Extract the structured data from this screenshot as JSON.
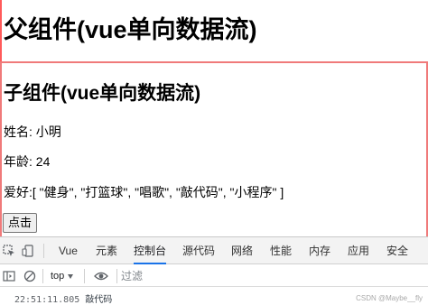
{
  "parent": {
    "title": "父组件(vue单向数据流)"
  },
  "child": {
    "title": "子组件(vue单向数据流)",
    "name_line": "姓名: 小明",
    "age_line": "年龄: 24",
    "hobby_line": "爱好:[ \"健身\", \"打篮球\", \"唱歌\", \"敲代码\", \"小程序\" ]",
    "button_label": "点击"
  },
  "devtools": {
    "tabs": [
      "Vue",
      "元素",
      "控制台",
      "源代码",
      "网络",
      "性能",
      "内存",
      "应用",
      "安全"
    ],
    "active_tab": "控制台",
    "context_label": "top",
    "filter_placeholder": "过滤",
    "log": {
      "timestamp": "22:51:11.805",
      "message": "敲代码"
    }
  },
  "watermark": "CSDN @Maybe__fly",
  "colors": {
    "border_red": "#ff5a5a",
    "active_tab_underline": "#1a73e8"
  },
  "icons": [
    "inspect-element-icon",
    "device-toolbar-icon",
    "sidebar-toggle-icon",
    "clear-console-icon",
    "live-expression-eye-icon"
  ]
}
